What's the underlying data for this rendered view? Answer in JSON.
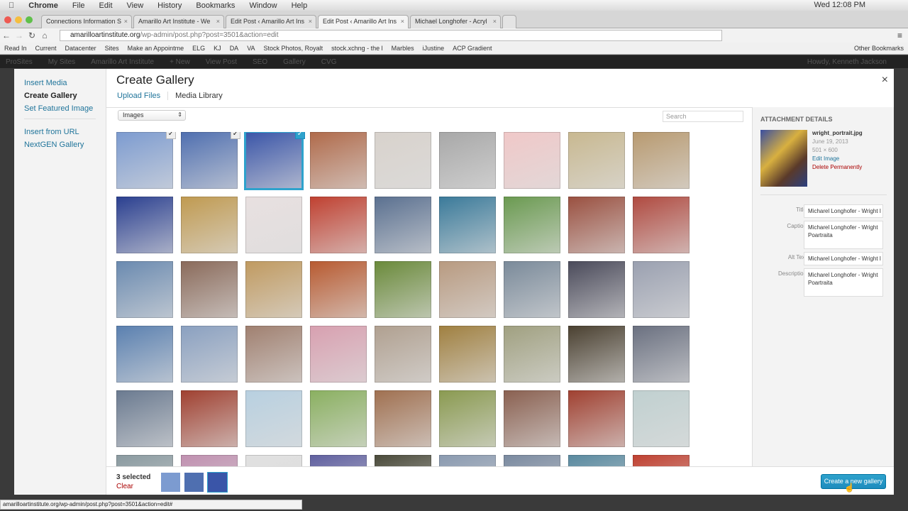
{
  "menubar": {
    "app": "Chrome",
    "items": [
      "File",
      "Edit",
      "View",
      "History",
      "Bookmarks",
      "Window",
      "Help"
    ],
    "clock": "Wed 12:08 PM"
  },
  "tabs": [
    {
      "label": "Connections Information S",
      "active": false
    },
    {
      "label": "Amarillo Art Institute - We",
      "active": false
    },
    {
      "label": "Edit Post ‹ Amarillo Art Ins",
      "active": false
    },
    {
      "label": "Edit Post ‹ Amarillo Art Ins",
      "active": true
    },
    {
      "label": "Michael Longhofer - Acryl",
      "active": false
    }
  ],
  "address": {
    "host": "amarilloartinstitute.org",
    "path": "/wp-admin/post.php?post=3501&action=edit"
  },
  "bookmarks": {
    "items": [
      "Read In",
      "Current",
      "Datacenter",
      "Sites",
      "Make an Appointme",
      "ELG",
      "KJ",
      "DA",
      "VA",
      "Stock Photos, Royalt",
      "stock.xchng - the l",
      "Marbles",
      "iJustine",
      "ACP Gradient"
    ],
    "other": "Other Bookmarks"
  },
  "wpbar": {
    "items": [
      "ProSites",
      "My Sites",
      "Amarillo Art Institute",
      "+ New",
      "View Post",
      "SEO",
      "Gallery",
      "CVG"
    ],
    "howdy": "Howdy, Kenneth Jackson"
  },
  "modal": {
    "menu": [
      "Insert Media",
      "Create Gallery",
      "Set Featured Image",
      "Insert from URL",
      "NextGEN Gallery"
    ],
    "title": "Create Gallery",
    "routes": [
      "Upload Files",
      "Media Library"
    ],
    "filter": "Images",
    "search_placeholder": "Search",
    "close": "×"
  },
  "thumbnails": [
    "#7c9bd0",
    "#4f6fb0",
    "#3a55a8",
    "#b06a4a",
    "#d8d2cc",
    "#a8a8a8",
    "#f0c8c8",
    "#c8b890",
    "#b89a70",
    "#2a3f90",
    "#c09a50",
    "#e8e0e0",
    "#c04030",
    "#5a7090",
    "#3a7a9a",
    "#6a9a50",
    "#9a5040",
    "#b04a40",
    "#6a8ab0",
    "#8a6a5a",
    "#c09a60",
    "#b85a30",
    "#6a8a3a",
    "#b89a80",
    "#7a8a9a",
    "#4a4a5a",
    "#9aa0b0",
    "#5a80b0",
    "#8aa0c0",
    "#a08070",
    "#d8a0b0",
    "#b0a090",
    "#a08040",
    "#a0a080",
    "#4a4030",
    "#6a7080",
    "#6a7a90",
    "#a04030",
    "#b8d0e0",
    "#8ab060",
    "#a07050",
    "#8a9a50",
    "#8a6050",
    "#a04030",
    "#c0d0d0",
    "#8a9aa0",
    "#c090b0",
    "#e0e0e0",
    "#6060a0",
    "#4a4a3a",
    "#8a9ab0",
    "#7a8aa0",
    "#5a8aa0",
    "#c04030"
  ],
  "selected_indices": [
    0,
    1,
    2
  ],
  "active_index": 2,
  "attachment": {
    "heading": "ATTACHMENT DETAILS",
    "filename": "wright_portrait.jpg",
    "date": "June 19, 2013",
    "dimensions": "501 × 600",
    "edit": "Edit Image",
    "delete": "Delete Permanently",
    "fields": [
      {
        "label": "Title",
        "value": "Micharel Longhofer - Wright I"
      },
      {
        "label": "Caption",
        "value": "Micharel Longhofer - Wright Poartraita"
      },
      {
        "label": "Alt Text",
        "value": "Micharel Longhofer - Wright I"
      },
      {
        "label": "Description",
        "value": "Micharel Longhofer - Wright Poartraita"
      }
    ]
  },
  "toolbar": {
    "count": "3 selected",
    "clear": "Clear",
    "create": "Create a new gallery"
  },
  "status": "amarilloartinstitute.org/wp-admin/post.php?post=3501&action=edit#",
  "colors": {
    "accent": "#2ea2cc",
    "link": "#21759b",
    "danger": "#aa0000"
  }
}
